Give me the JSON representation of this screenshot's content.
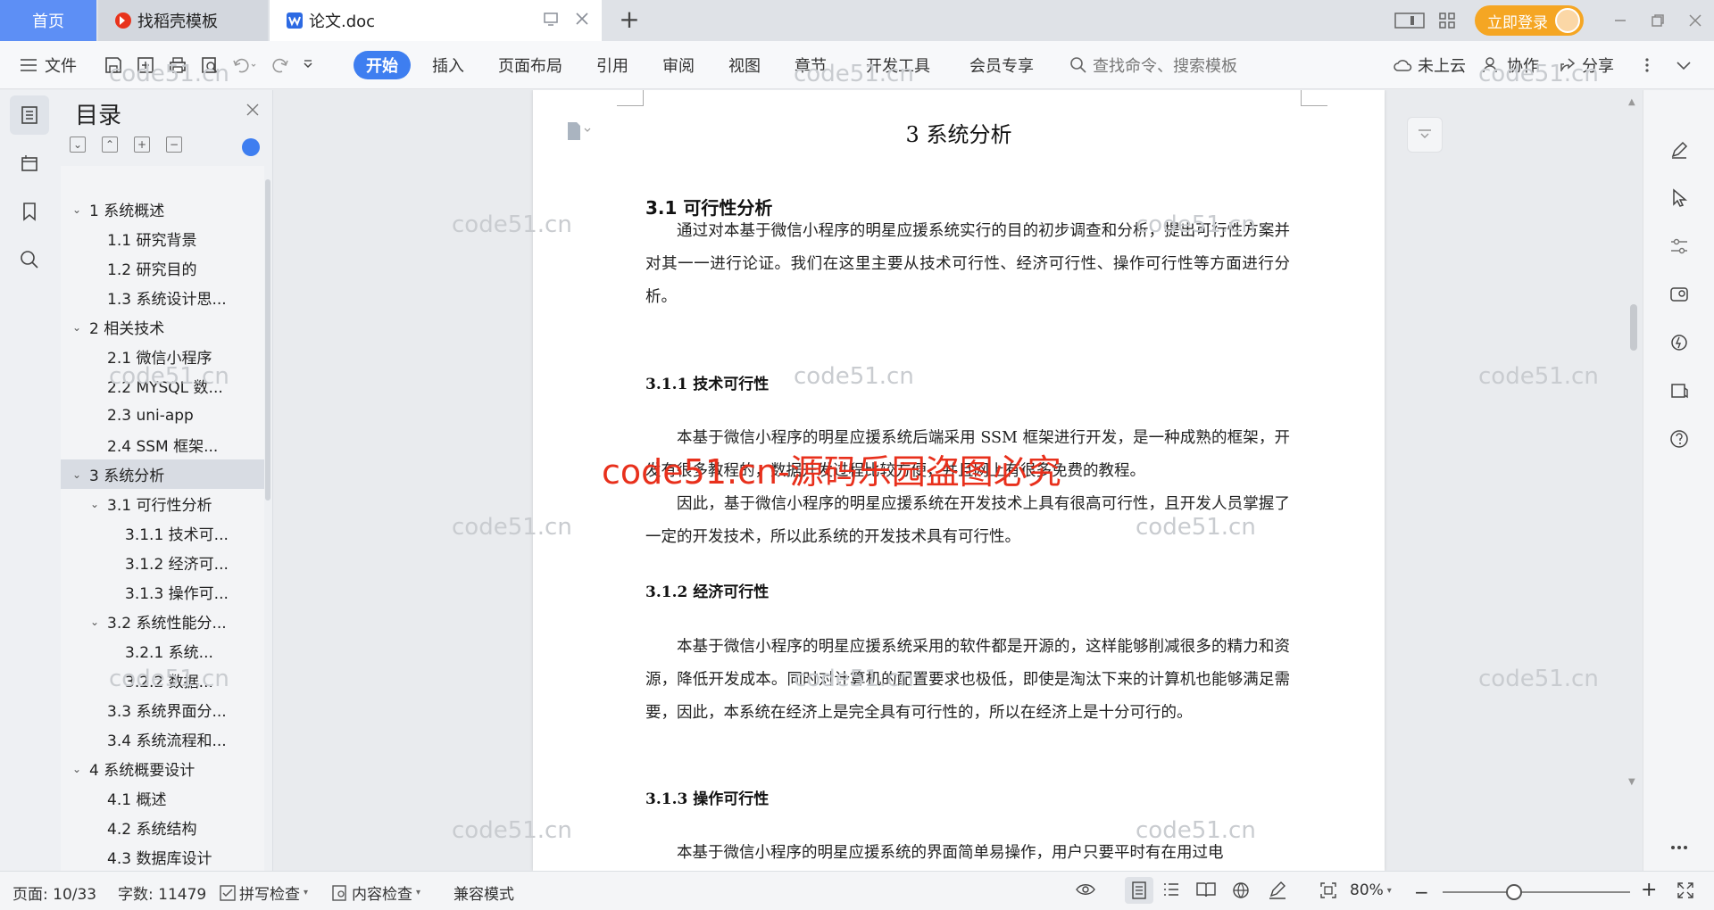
{
  "tabs": {
    "home": "首页",
    "templates": "找稻壳模板",
    "document": "论文.doc",
    "new_tab": "+"
  },
  "titlebar": {
    "login": "立即登录"
  },
  "menu": {
    "file": "文件",
    "start": "开始",
    "insert": "插入",
    "layout": "页面布局",
    "reference": "引用",
    "review": "审阅",
    "view": "视图",
    "section": "章节",
    "developer": "开发工具",
    "member": "会员专享",
    "search_placeholder": "查找命令、搜索模板",
    "cloud": "未上云",
    "collab": "协作",
    "share": "分享"
  },
  "toc": {
    "title": "目录",
    "items": [
      {
        "label": "1 系统概述",
        "level": 1,
        "expanded": true
      },
      {
        "label": "1.1  研究背景",
        "level": 2
      },
      {
        "label": "1.2 研究目的",
        "level": 2
      },
      {
        "label": "1.3 系统设计思...",
        "level": 2
      },
      {
        "label": "2 相关技术",
        "level": 1,
        "expanded": true
      },
      {
        "label": "2.1 微信小程序",
        "level": 2
      },
      {
        "label": "2.2 MYSQL 数...",
        "level": 2
      },
      {
        "label": "2.3 uni-app",
        "level": 2
      },
      {
        "label": "2.4 SSM 框架...",
        "level": 2
      },
      {
        "label": "3 系统分析",
        "level": 1,
        "expanded": true,
        "selected": true
      },
      {
        "label": "3.1 可行性分析",
        "level": 2,
        "expanded": true
      },
      {
        "label": "3.1.1 技术可...",
        "level": 3
      },
      {
        "label": "3.1.2 经济可...",
        "level": 3
      },
      {
        "label": "3.1.3 操作可...",
        "level": 3
      },
      {
        "label": "3.2 系统性能分...",
        "level": 2,
        "expanded": true
      },
      {
        "label": "3.2.1  系统...",
        "level": 3
      },
      {
        "label": "3.2.2  数据...",
        "level": 3
      },
      {
        "label": "3.3 系统界面分...",
        "level": 2
      },
      {
        "label": "3.4 系统流程和...",
        "level": 2
      },
      {
        "label": "4 系统概要设计",
        "level": 1,
        "expanded": true
      },
      {
        "label": "4.1 概述",
        "level": 2
      },
      {
        "label": "4.2 系统结构",
        "level": 2
      },
      {
        "label": "4.3 数据库设计",
        "level": 2
      }
    ]
  },
  "document": {
    "chapter_title": "3 系统分析",
    "section_title": "3.1 可行性分析",
    "intro": "通过对本基于微信小程序的明星应援系统实行的目的初步调查和分析，提出可行性方案并对其一一进行论证。我们在这里主要从技术可行性、经济可行性、操作可行性等方面进行分析。",
    "tech_title": "3.1.1 技术可行性",
    "tech_p1": "本基于微信小程序的明星应援系统后端采用 SSM 框架进行开发，是一种成熟的框架，开发有很多教程的，数据开发过程比较方便，并且网上有很多免费的教程。",
    "tech_p2": "因此，基于微信小程序的明星应援系统在开发技术上具有很高可行性，且开发人员掌握了一定的开发技术，所以此系统的开发技术具有可行性。",
    "econ_title": "3.1.2 经济可行性",
    "econ_p1": "本基于微信小程序的明星应援系统采用的软件都是开源的，这样能够削减很多的精力和资源，降低开发成本。同时对计算机的配置要求也极低，即使是淘汰下来的计算机也能够满足需要，因此，本系统在经济上是完全具有可行性的，所以在经济上是十分可行的。",
    "oper_title": "3.1.3 操作可行性",
    "oper_p1": "本基于微信小程序的明星应援系统的界面简单易操作，用户只要平时有在用过电"
  },
  "watermarks": {
    "small": "code51.cn",
    "red": "code51.cn-源码乐园盗图必究"
  },
  "status": {
    "page": "页面: 10/33",
    "words": "字数: 11479",
    "spell": "拼写检查",
    "content_check": "内容检查",
    "compat": "兼容模式",
    "zoom": "80%"
  }
}
